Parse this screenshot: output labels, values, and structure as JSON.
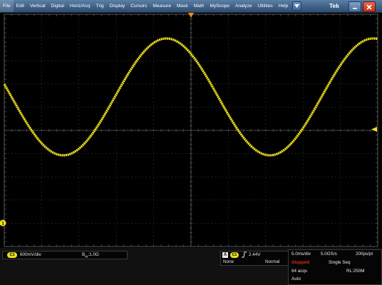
{
  "menu": {
    "items": [
      "File",
      "Edit",
      "Vertical",
      "Digital",
      "Horiz/Acq",
      "Trig",
      "Display",
      "Cursors",
      "Measure",
      "Mask",
      "Math",
      "MyScope",
      "Analyze",
      "Utilities",
      "Help"
    ]
  },
  "brand": "Tek",
  "waveform": {
    "color": "#f0e21b",
    "grid_color": "#5a5a5a",
    "channel_marker_label": "1"
  },
  "channel": {
    "badge": "C1",
    "scale": "600mV/div",
    "bandwidth": "B",
    "bandwidth_sub": "W",
    "bandwidth_value": ":1.0G"
  },
  "trigger": {
    "source_letter": "A",
    "source_channel": "C1",
    "slope_symbol": "⌠",
    "level": "2.44V",
    "coupling": "None",
    "mode": "Normal"
  },
  "acquisition": {
    "timebase": "5.0ms/div",
    "sample_rate": "5.0GS/s",
    "resolution": "200ps/pt",
    "status": "Stopped",
    "sequence": "Single Seq",
    "acqs": "64 acqs",
    "record_length": "RL:250M",
    "mode": "Auto"
  },
  "colors": {
    "trace": "#f0e21b",
    "trigger_marker": "#f08a1a",
    "stopped": "#e0281c",
    "menubar": "#3f5f86"
  }
}
